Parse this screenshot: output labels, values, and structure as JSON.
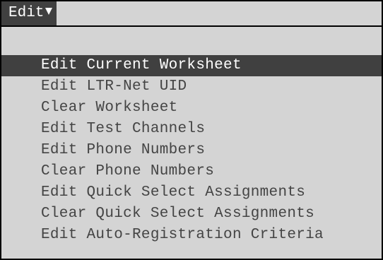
{
  "menu": {
    "title": "Edit",
    "caret_icon": "triangle-down-icon",
    "items": [
      {
        "label": "Edit Current Worksheet",
        "selected": true
      },
      {
        "label": "Edit LTR-Net UID",
        "selected": false
      },
      {
        "label": "Clear Worksheet",
        "selected": false
      },
      {
        "label": "Edit Test Channels",
        "selected": false
      },
      {
        "label": "Edit Phone Numbers",
        "selected": false
      },
      {
        "label": "Clear Phone Numbers",
        "selected": false
      },
      {
        "label": "Edit Quick Select Assignments",
        "selected": false
      },
      {
        "label": "Clear Quick Select Assignments",
        "selected": false
      },
      {
        "label": "Edit Auto-Registration Criteria",
        "selected": false
      }
    ]
  },
  "colors": {
    "background": "#d4d4d4",
    "highlight": "#404040",
    "highlight_text": "#ffffff",
    "item_text": "#444444"
  }
}
